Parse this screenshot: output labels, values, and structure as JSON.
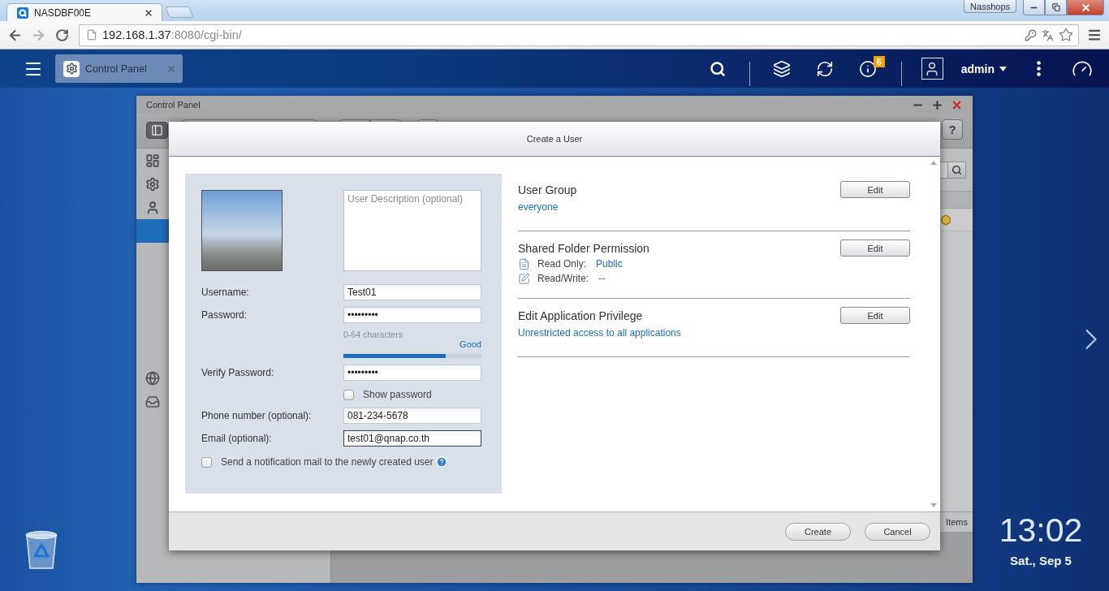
{
  "browser": {
    "tab": {
      "title": "NASDBF00E"
    },
    "profile": "Nasshops",
    "url": {
      "host": "192.168.1.37",
      "path": ":8080/cgi-bin/"
    }
  },
  "app_bar": {
    "tabs": [
      {
        "label": "Control Panel",
        "selected": true
      }
    ],
    "notifications": "6",
    "user": "admin"
  },
  "control_panel": {
    "title": "Control Panel",
    "help": "?",
    "sidebar": [
      {
        "items": [
          {
            "kind": "dashboard",
            "selected": false
          },
          {
            "kind": "settings",
            "selected": false
          },
          {
            "kind": "user",
            "selected": false
          },
          {
            "kind": "entry",
            "selected": true
          }
        ]
      },
      {
        "items": [
          {
            "kind": "network",
            "selected": false
          },
          {
            "kind": "storage",
            "selected": false
          }
        ]
      }
    ],
    "status": "Items"
  },
  "dialog": {
    "title": "Create a User",
    "description": {
      "placeholder": "User Description (optional)"
    },
    "rows": [
      {
        "kind": "input",
        "label": "Username:",
        "value": "Test01",
        "focused": false
      },
      {
        "kind": "input",
        "label": "Password:",
        "value": "•••••••••",
        "focused": false
      },
      {
        "kind": "strength",
        "hint": "0-64 characters",
        "rating": "Good",
        "level": 0.74
      },
      {
        "kind": "input",
        "label": "Verify Password:",
        "value": "•••••••••",
        "focused": false
      },
      {
        "kind": "checkbox",
        "label": "Show password",
        "checked": false
      },
      {
        "kind": "input",
        "label": "Phone number (optional):",
        "value": "081-234-5678",
        "focused": false
      },
      {
        "kind": "input",
        "label": "Email (optional):",
        "value": "test01@qnap.co.th",
        "focused": true
      }
    ],
    "notify": {
      "label": "Send a notification mail to the newly created user",
      "checked": false
    },
    "sections": [
      {
        "title": "User Group",
        "button": "Edit",
        "link": "everyone"
      },
      {
        "title": "Shared Folder Permission",
        "button": "Edit",
        "permissions": [
          {
            "kind": "read",
            "label": "Read Only:",
            "value": "Public"
          },
          {
            "kind": "write",
            "label": "Read/Write:",
            "value": "--"
          }
        ]
      },
      {
        "title": "Edit Application Privilege",
        "button": "Edit",
        "link": "Unrestricted access to all applications"
      }
    ],
    "buttons": [
      "Create",
      "Cancel"
    ]
  },
  "desktop": {
    "time": "13:02",
    "date": "Sat., Sep 5"
  }
}
